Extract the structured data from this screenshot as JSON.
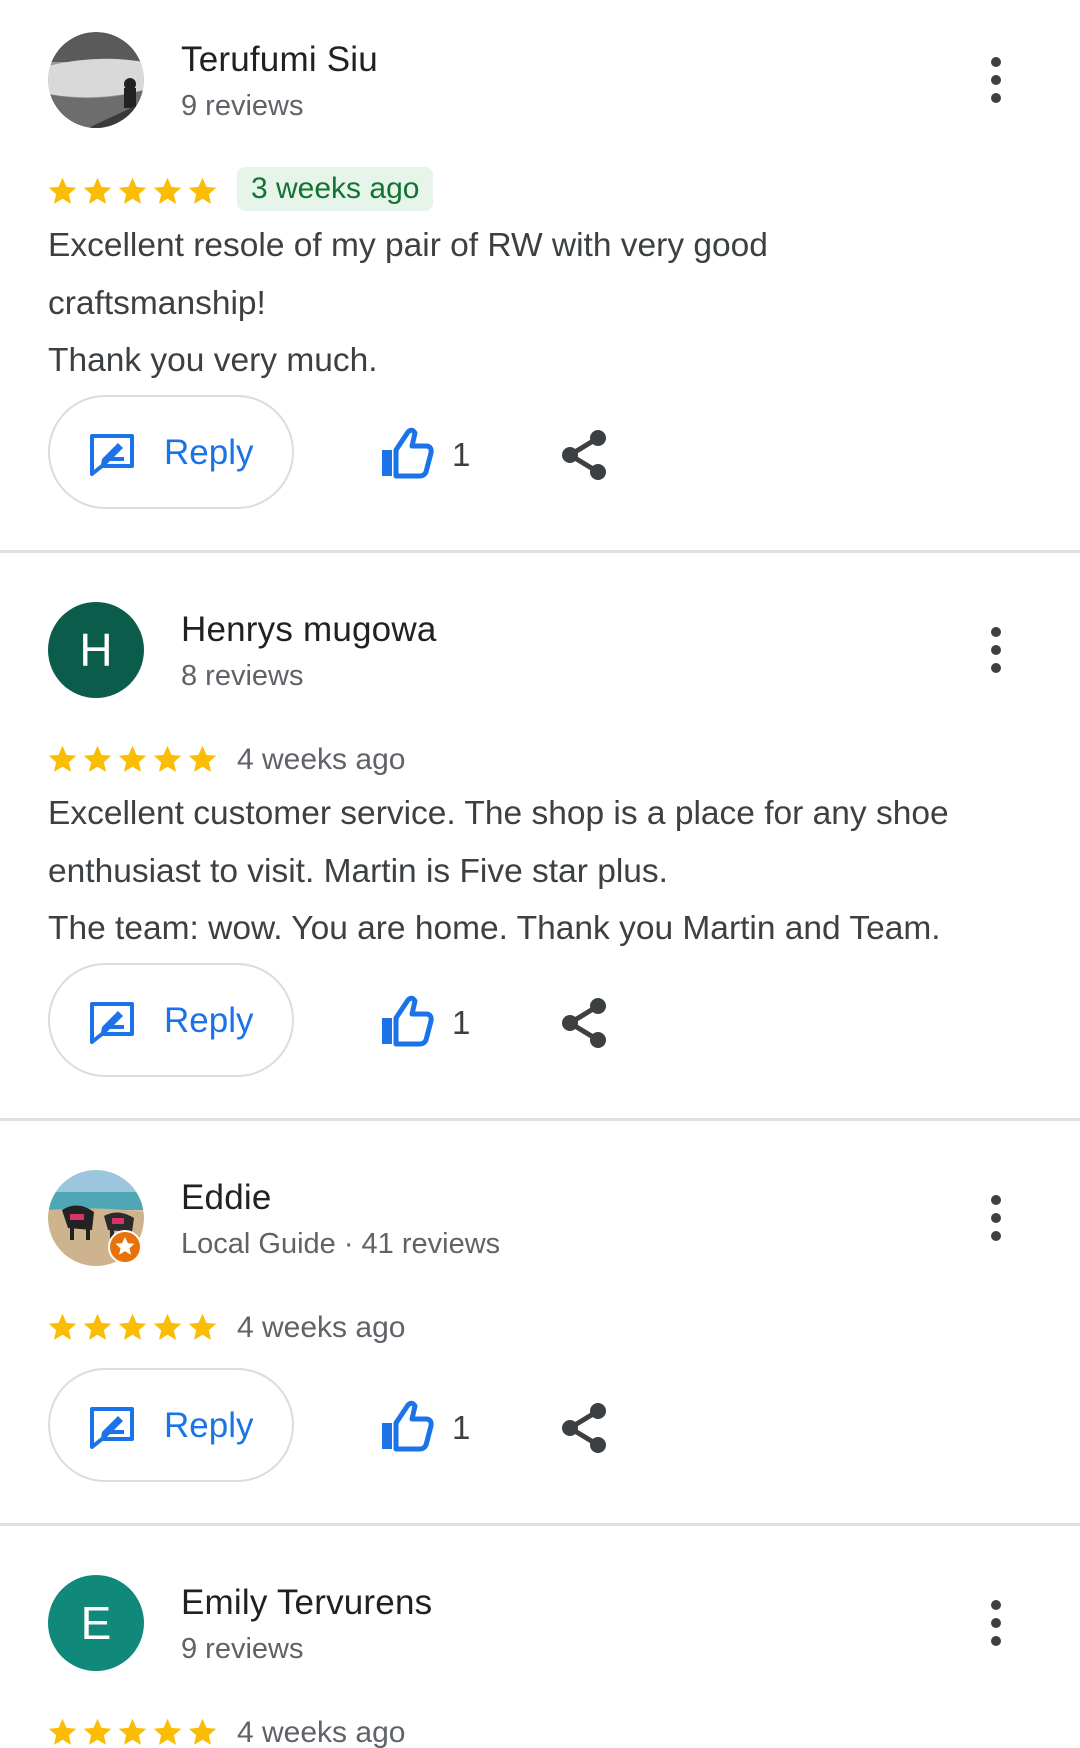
{
  "colors": {
    "star": "#fbbc04",
    "accent_blue": "#1a73e8",
    "divider": "#e0e0e0",
    "new_badge_bg": "#e6f4ea",
    "new_badge_text": "#137333"
  },
  "reviews": [
    {
      "name": "Terufumi Siu",
      "subtitle": "9 reviews",
      "avatar": {
        "type": "photo",
        "icon": "profile-photo"
      },
      "rating": 5,
      "date": "3 weeks ago",
      "text": "Excellent resole of my pair of RW with very good\ncraftsmanship!\nThank you very much.",
      "reply_label": "Reply",
      "likes": "1"
    },
    {
      "name": "Henrys mugowa",
      "subtitle": "8 reviews",
      "avatar": {
        "type": "letter",
        "letter": "H",
        "color": "#0b5c4a"
      },
      "rating": 5,
      "date": "4 weeks ago",
      "text": "Excellent customer service. The shop is a place for any shoe\nenthusiast to visit. Martin is Five star plus.\nThe team: wow. You are home. Thank you Martin and Team.",
      "reply_label": "Reply",
      "likes": "1"
    },
    {
      "name": "Eddie",
      "subtitle": "Local Guide · 41 reviews",
      "avatar": {
        "type": "photo",
        "icon": "profile-photo",
        "badge": "local-guide-star-icon"
      },
      "rating": 5,
      "date": "4 weeks ago",
      "text": "",
      "reply_label": "Reply",
      "likes": "1"
    },
    {
      "name": "Emily Tervurens",
      "subtitle": "9 reviews",
      "avatar": {
        "type": "letter",
        "letter": "E",
        "color": "#11897a"
      },
      "rating": 5,
      "date": "4 weeks ago"
    }
  ]
}
